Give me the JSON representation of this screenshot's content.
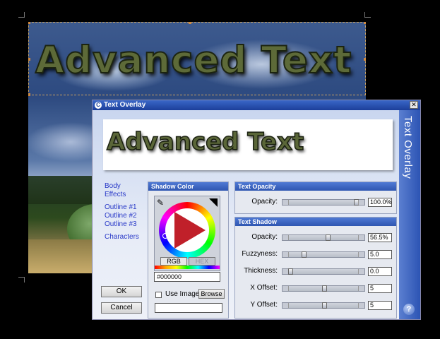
{
  "canvas": {
    "overlay_text": "Advanced Text"
  },
  "dialog": {
    "title": "Text Overlay",
    "sidebar_title": "Text Overlay",
    "close_glyph": "✕",
    "help_glyph": "?",
    "preview_text": "Advanced Text",
    "nav": [
      "Body",
      "Effects",
      "Outline #1",
      "Outline #2",
      "Outline #3",
      "Characters"
    ],
    "ok_label": "OK",
    "cancel_label": "Cancel",
    "shadow_color": {
      "title": "Shadow Color",
      "tab_rgb": "RGB",
      "tab_hex": "HEX",
      "hex_value": "#000000",
      "use_image_label": "Use Image",
      "browse_label": "Browse",
      "use_image_checked": false
    },
    "text_opacity": {
      "title": "Text Opacity",
      "label": "Opacity:",
      "value": "100.0%",
      "level": 1.0
    },
    "text_shadow": {
      "title": "Text Shadow",
      "rows": [
        {
          "label": "Opacity:",
          "value": "56.5%",
          "level": 0.565
        },
        {
          "label": "Fuzzyness:",
          "value": "5.0",
          "level": 0.2
        },
        {
          "label": "Thickness:",
          "value": "0.0",
          "level": 0.0
        },
        {
          "label": "X Offset:",
          "value": "5",
          "level": 0.52
        },
        {
          "label": "Y Offset:",
          "value": "5",
          "level": 0.52
        }
      ]
    }
  }
}
